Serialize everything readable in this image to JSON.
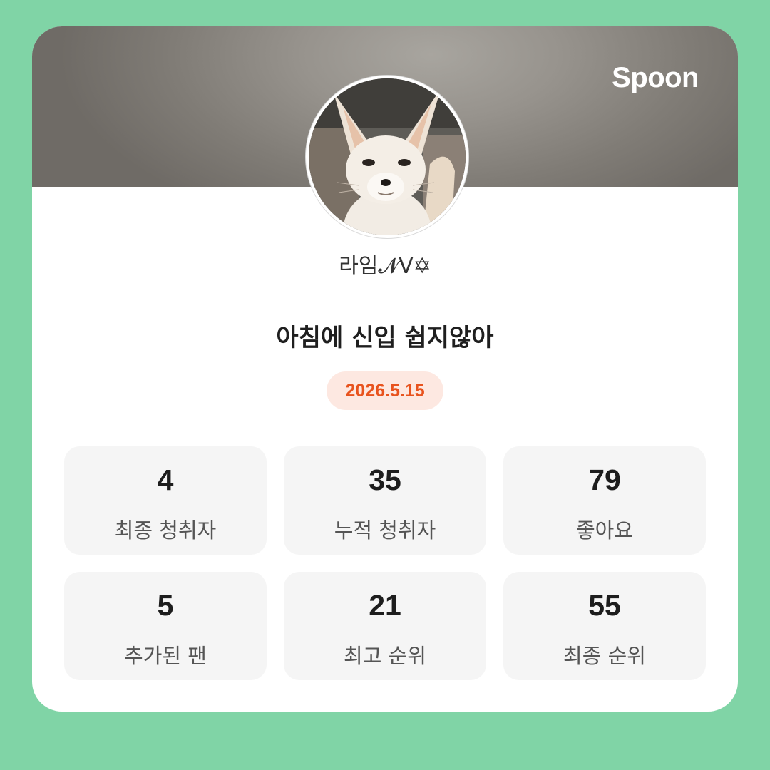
{
  "brand": "Spoon",
  "profile": {
    "nickname": "라임𝓝V✡"
  },
  "broadcast": {
    "title": "아침에 신입 쉽지않아",
    "date": "2026.5.15"
  },
  "stats": [
    {
      "value": "4",
      "label": "최종 청취자"
    },
    {
      "value": "35",
      "label": "누적 청취자"
    },
    {
      "value": "79",
      "label": "좋아요"
    },
    {
      "value": "5",
      "label": "추가된 팬"
    },
    {
      "value": "21",
      "label": "최고 순위"
    },
    {
      "value": "55",
      "label": "최종 순위"
    }
  ],
  "colors": {
    "background": "#80d4a6",
    "card": "#ffffff",
    "date_text": "#e8531e",
    "date_badge": "#fde8e1",
    "stat_tile": "#f5f5f5"
  },
  "icons": {
    "avatar": "fennec-fox-photo"
  }
}
